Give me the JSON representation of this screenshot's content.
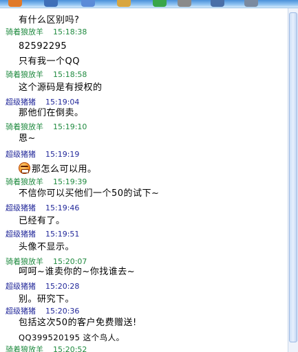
{
  "toolbar": {
    "icons": [
      "color-icon",
      "edit-icon",
      "font-icon",
      "folder-icon",
      "add-icon",
      "document-icon",
      "capture-icon",
      "settings-icon"
    ]
  },
  "messages": [
    {
      "type": "text",
      "text": "有什么区别吗?"
    },
    {
      "type": "sender",
      "nick": "骑着狼放羊",
      "time": "15:18:38",
      "color": "#1f8a3f"
    },
    {
      "type": "text",
      "text": "82592295"
    },
    {
      "type": "text",
      "text": "只有我一个QQ"
    },
    {
      "type": "sender",
      "nick": "骑着狼放羊",
      "time": "15:18:58",
      "color": "#1f8a3f"
    },
    {
      "type": "text",
      "text": "这个源码是有授权的"
    },
    {
      "type": "sender",
      "nick": "超级猪猪",
      "time": "15:19:04",
      "color": "#22289a"
    },
    {
      "type": "text",
      "text": "那他们在倒卖。"
    },
    {
      "type": "sender",
      "nick": "骑着狼放羊",
      "time": "15:19:10",
      "color": "#1f8a3f"
    },
    {
      "type": "text",
      "text": "恩~"
    },
    {
      "type": "sender",
      "nick": "超级猪猪",
      "time": "15:19:19",
      "color": "#22289a"
    },
    {
      "type": "emoji-text",
      "emoji": "angry-face-icon",
      "text": "那怎么可以用。"
    },
    {
      "type": "sender",
      "nick": "骑着狼放羊",
      "time": "15:19:39",
      "color": "#1f8a3f"
    },
    {
      "type": "text",
      "text": "不信你可以买他们一个50的试下~"
    },
    {
      "type": "sender",
      "nick": "超级猪猪",
      "time": "15:19:46",
      "color": "#22289a"
    },
    {
      "type": "text",
      "text": "已经有了。"
    },
    {
      "type": "sender",
      "nick": "超级猪猪",
      "time": "15:19:51",
      "color": "#22289a"
    },
    {
      "type": "text",
      "text": "头像不显示。"
    },
    {
      "type": "sender",
      "nick": "骑着狼放羊",
      "time": "15:20:07",
      "color": "#1f8a3f"
    },
    {
      "type": "text",
      "text": "呵呵~谁卖你的~你找谁去~"
    },
    {
      "type": "sender",
      "nick": "超级猪猪",
      "time": "15:20:28",
      "color": "#22289a"
    },
    {
      "type": "text",
      "text": "别。研究下。"
    },
    {
      "type": "sender",
      "nick": "超级猪猪",
      "time": "15:20:36",
      "color": "#22289a"
    },
    {
      "type": "text",
      "text": "包括这次50的客户免费赠送!"
    },
    {
      "type": "text",
      "small": true,
      "text": "QQ399520195 这个鸟人。"
    },
    {
      "type": "sender",
      "nick": "骑着狼放羊",
      "time": "15:20:52",
      "color": "#1f8a3f"
    }
  ]
}
